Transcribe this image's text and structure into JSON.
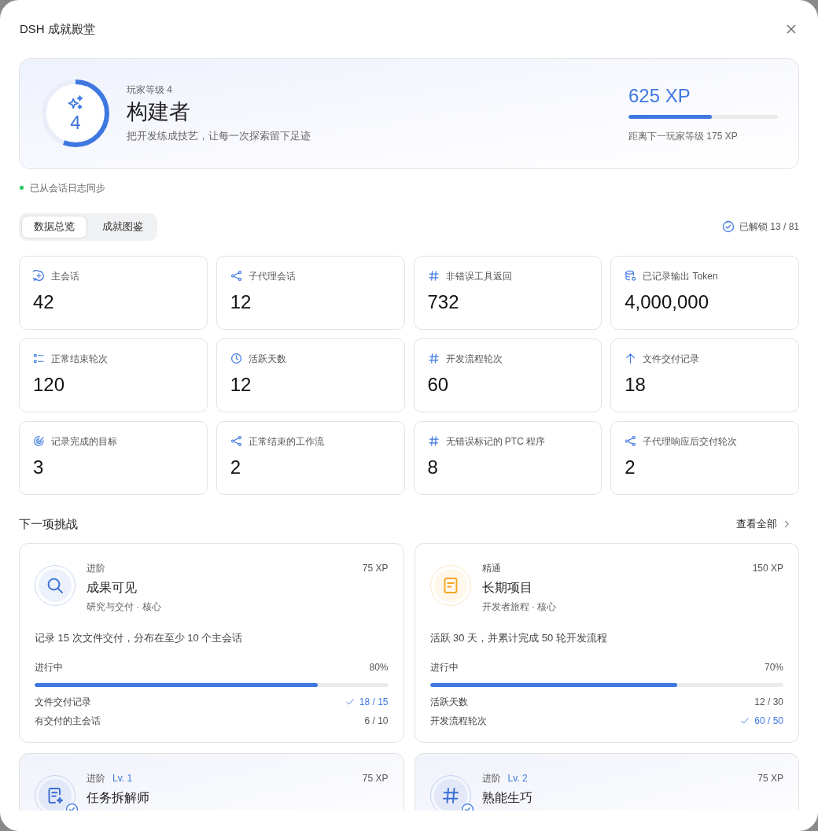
{
  "window": {
    "title": "DSH 成就殿堂"
  },
  "player": {
    "level_label": "玩家等级 4",
    "badge": "4",
    "rank": "构建者",
    "motto": "把开发练成技艺，让每一次探索留下足迹",
    "level": 0.56,
    "xp": "625 XP",
    "xp_progress": {
      "level": 0.56
    },
    "next": "距离下一玩家等级 175 XP"
  },
  "sync": {
    "text": "已从会话日志同步",
    "color": "#22c55e"
  },
  "tabs": [
    {
      "label": "数据总览",
      "selected": true
    },
    {
      "label": "成就图鉴",
      "selected": false
    }
  ],
  "unlocked": "已解锁 13 / 81",
  "stats": [
    {
      "kind": "session",
      "label": "主会话",
      "value": "42"
    },
    {
      "kind": "branch",
      "label": "子代理会话",
      "value": "12"
    },
    {
      "kind": "count",
      "label": "非错误工具返回",
      "value": "732"
    },
    {
      "kind": "storage",
      "label": "已记录输出 Token",
      "value": "4,000,000"
    },
    {
      "kind": "list",
      "label": "正常结束轮次",
      "value": "120"
    },
    {
      "kind": "time",
      "label": "活跃天数",
      "value": "12"
    },
    {
      "kind": "count",
      "label": "开发流程轮次",
      "value": "60"
    },
    {
      "kind": "upload",
      "label": "文件交付记录",
      "value": "18"
    },
    {
      "kind": "goal",
      "label": "记录完成的目标",
      "value": "3"
    },
    {
      "kind": "branch",
      "label": "正常结束的工作流",
      "value": "2"
    },
    {
      "kind": "count",
      "label": "无错误标记的 PTC 程序",
      "value": "8"
    },
    {
      "kind": "branch",
      "label": "子代理响应后交付轮次",
      "value": "2"
    }
  ],
  "challenges": {
    "title": "下一项挑战",
    "view_all": "查看全部",
    "cards": [
      {
        "kind": "search",
        "color": "#3b6fd4",
        "unlocked": false,
        "tier": "进阶",
        "xp": "75 XP",
        "title": "成果可见",
        "subtitle": "研究与交付 · 核心",
        "description": "记录 15 次文件交付，分布在至少 10 个主会话",
        "status": "进行中",
        "percent": "80%",
        "level": 0.8,
        "requirements": [
          {
            "label": "文件交付记录",
            "value": "18 / 15",
            "met": true
          },
          {
            "label": "有交付的主会话",
            "value": "6 / 10",
            "met": false
          }
        ]
      },
      {
        "kind": "document",
        "color": "#f5a524",
        "unlocked": false,
        "tier": "精通",
        "xp": "150 XP",
        "title": "长期项目",
        "subtitle": "开发者旅程 · 核心",
        "description": "活跃 30 天，并累计完成 50 轮开发流程",
        "status": "进行中",
        "percent": "70%",
        "level": 0.7,
        "requirements": [
          {
            "label": "活跃天数",
            "value": "12 / 30",
            "met": false
          },
          {
            "label": "开发流程轮次",
            "value": "60 / 50",
            "met": true
          }
        ]
      },
      {
        "kind": "task",
        "color": "#3b6fd4",
        "unlocked": true,
        "tier": "进阶",
        "badge": "Lv. 1",
        "xp": "75 XP",
        "title": "任务拆解师"
      },
      {
        "kind": "count",
        "color": "#3b6fd4",
        "unlocked": true,
        "tier": "进阶",
        "badge": "Lv. 2",
        "xp": "75 XP",
        "title": "熟能生巧"
      }
    ]
  }
}
